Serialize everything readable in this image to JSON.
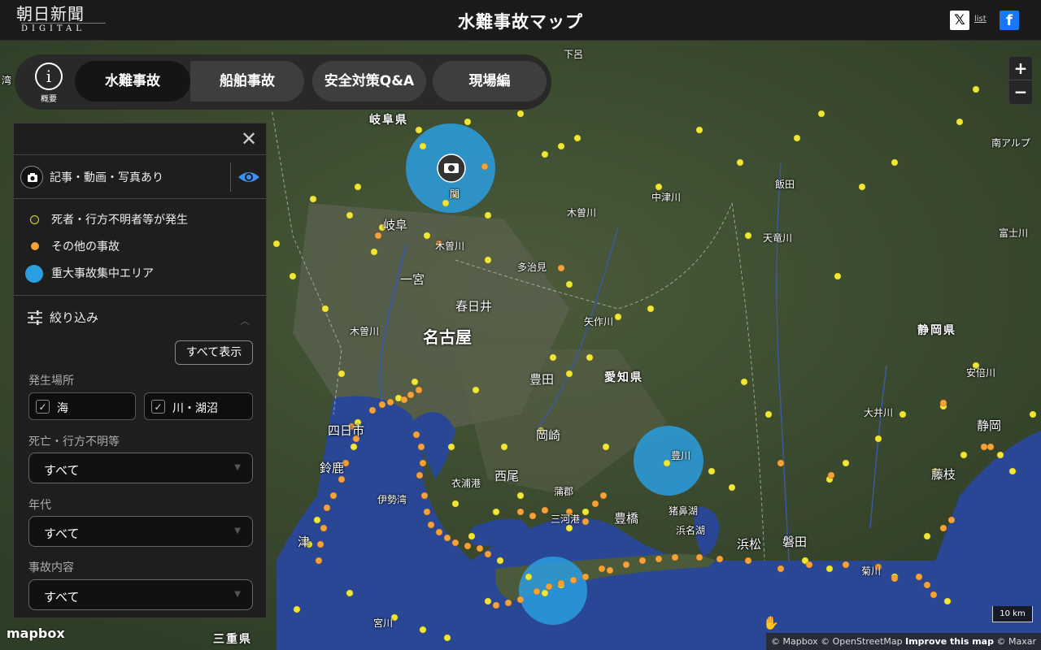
{
  "header": {
    "logo_line1": "朝日新聞",
    "logo_line2": "DIGITAL",
    "title": "水難事故マップ",
    "x_icon": "x-logo-icon",
    "list_label": "list",
    "fb_icon": "facebook-icon"
  },
  "tabs": {
    "about_label": "概要",
    "items": [
      {
        "label": "水難事故",
        "active": true
      },
      {
        "label": "船舶事故",
        "active": false
      },
      {
        "label": "安全対策Q&A",
        "active": false
      },
      {
        "label": "現場編",
        "active": false
      }
    ]
  },
  "panel": {
    "media_label": "記事・動画・写真あり",
    "legend": [
      {
        "label": "死者・行方不明者等が発生",
        "color": "#d8dc2a"
      },
      {
        "label": "その他の事故",
        "color": "#f5a23a"
      },
      {
        "label": "重大事故集中エリア",
        "color": "#2a9ee0"
      }
    ],
    "filter_title": "絞り込み",
    "show_all": "すべて表示",
    "location_label": "発生場所",
    "location_options": [
      "海",
      "川・湖沼"
    ],
    "death_label": "死亡・行方不明等",
    "death_value": "すべて",
    "age_label": "年代",
    "age_value": "すべて",
    "type_label": "事故内容",
    "type_value": "すべて"
  },
  "map": {
    "labels": {
      "shimoro": "下呂",
      "gifu_pref": "岐阜県",
      "seki": "関",
      "gifu": "岐阜",
      "kisogawa1": "木曽川",
      "kisogawa2": "木曽川",
      "kisogawa3": "木曽川",
      "tajimi": "多治見",
      "ichinomiya": "一宮",
      "kasugai": "春日井",
      "nagoya": "名古屋",
      "yahagigawa": "矢作川",
      "toyota": "豊田",
      "aichi_pref": "愛知県",
      "nakatsugawa": "中津川",
      "iida": "飯田",
      "tenryugawa": "天竜川",
      "minami_alps": "南アルプ",
      "fujikawa": "富士川",
      "shizuoka_pref": "静岡県",
      "abegawa": "安倍川",
      "oigawa": "大井川",
      "shizuoka": "静岡",
      "fujieda": "藤枝",
      "yokkaichi": "四日市",
      "suzuka": "鈴鹿",
      "isewan": "伊勢湾",
      "kinuura": "衣浦港",
      "okazaki": "岡崎",
      "nishio": "西尾",
      "gamagori": "蒲郡",
      "mikawako": "三河港",
      "toyohashi": "豊橋",
      "toyokawa": "豊川",
      "inohanako": "猪鼻湖",
      "hamanako": "浜名湖",
      "hamamatsu": "浜松",
      "iwata": "磐田",
      "kikugawa": "菊川",
      "tsu": "津",
      "miyagawa": "宮川",
      "mie_pref": "三重県",
      "bay_left": "湾"
    },
    "zoom_in": "+",
    "zoom_out": "−",
    "scale": "10 km",
    "logo": "mapbox",
    "attribution_1": "© Mapbox © OpenStreetMap",
    "attribution_2": "Improve this map",
    "attribution_3": "© Maxar",
    "camera_icon": "camera-icon",
    "hand_cursor": "✋"
  }
}
